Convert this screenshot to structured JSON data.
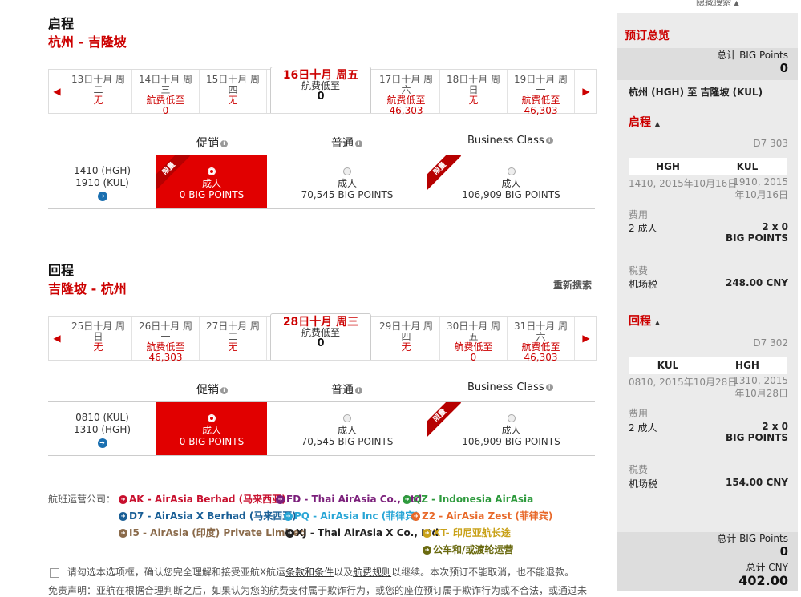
{
  "outbound": {
    "title": "启程",
    "route": "杭州 - 吉隆坡",
    "dates": [
      {
        "l1": "13日十月 周",
        "l2": "二",
        "p1": "无",
        "p2": ""
      },
      {
        "l1": "14日十月 周",
        "l2": "三",
        "p1": "航费低至",
        "p2": "0"
      },
      {
        "l1": "15日十月 周",
        "l2": "四",
        "p1": "无",
        "p2": ""
      },
      {
        "l1": "16日十月 周五",
        "l2": "航费低至",
        "p1": "0",
        "p2": "",
        "active": true
      },
      {
        "l1": "17日十月 周",
        "l2": "六",
        "p1": "航费低至",
        "p2": "46,303"
      },
      {
        "l1": "18日十月 周",
        "l2": "日",
        "p1": "无",
        "p2": ""
      },
      {
        "l1": "19日十月 周",
        "l2": "一",
        "p1": "航费低至",
        "p2": "46,303"
      }
    ],
    "times": {
      "dep": "1410 (HGH)",
      "arr": "1910 (KUL)"
    },
    "fares": [
      {
        "label": "成人",
        "points": "0 BIG POINTS"
      },
      {
        "label": "成人",
        "points": "70,545 BIG POINTS"
      },
      {
        "label": "成人",
        "points": "106,909 BIG POINTS"
      }
    ]
  },
  "return": {
    "title": "回程",
    "route": "吉隆坡 - 杭州",
    "research": "重新搜索",
    "dates": [
      {
        "l1": "25日十月 周",
        "l2": "日",
        "p1": "无",
        "p2": ""
      },
      {
        "l1": "26日十月 周",
        "l2": "一",
        "p1": "航费低至",
        "p2": "46,303"
      },
      {
        "l1": "27日十月 周",
        "l2": "二",
        "p1": "无",
        "p2": ""
      },
      {
        "l1": "28日十月 周三",
        "l2": "航费低至",
        "p1": "0",
        "p2": "",
        "active": true
      },
      {
        "l1": "29日十月 周",
        "l2": "四",
        "p1": "无",
        "p2": ""
      },
      {
        "l1": "30日十月 周",
        "l2": "五",
        "p1": "航费低至",
        "p2": "0"
      },
      {
        "l1": "31日十月 周",
        "l2": "六",
        "p1": "航费低至",
        "p2": "46,303"
      }
    ],
    "times": {
      "dep": "0810 (KUL)",
      "arr": "1310 (HGH)"
    },
    "fares": [
      {
        "label": "成人",
        "points": "0 BIG POINTS"
      },
      {
        "label": "成人",
        "points": "70,545 BIG POINTS"
      },
      {
        "label": "成人",
        "points": "106,909 BIG POINTS"
      }
    ]
  },
  "columns": {
    "promo": "促销",
    "regular": "普通",
    "business": "Business Class"
  },
  "ribbon": "限量",
  "carriers": {
    "label": "航班运营公司：",
    "items": [
      {
        "text": "AK - AirAsia Berhad (马来西亚)",
        "color": "#c8102e"
      },
      {
        "text": "FD - Thai AirAsia Co., Ltd",
        "color": "#7b1f7b"
      },
      {
        "text": "QZ - Indonesia AirAsia",
        "color": "#2e9a3d"
      },
      {
        "text": "D7 - AirAsia X Berhad (马来西亚)",
        "color": "#1a5f96"
      },
      {
        "text": "PQ - AirAsia Inc (菲律宾)",
        "color": "#29a6d6"
      },
      {
        "text": "Z2 - AirAsia Zest (菲律宾)",
        "color": "#e8692a"
      },
      {
        "text": "I5 - AirAsia (印度) Private Limited",
        "color": "#8a6a4a"
      },
      {
        "text": "XJ - Thai AirAsia X Co., Ltd",
        "color": "#222222"
      },
      {
        "text": "XT- 印尼亚航长途",
        "color": "#c9a21a"
      },
      {
        "text": "公车和/或渡轮运营",
        "color": "#6a6a10"
      }
    ]
  },
  "terms": {
    "pre": "请勾选本选项框，确认您完全理解和接受亚航X航运",
    "link1": "条款和条件",
    "mid": "以及",
    "link2": "航费规则",
    "post": "以继续。本次预订不能取消，也不能退款。"
  },
  "disclaimer": "免责声明：亚航在根据合理判断之后，如果认为您的航费支付属于欺诈行为，或您的座位预订属于欺诈行为或不合法，或通过未",
  "hide_search": "隐藏搜索",
  "sidebar": {
    "title": "预订总览",
    "total_label": "总计 BIG Points",
    "total_top": "0",
    "route": "杭州 (HGH) 至 吉隆坡 (KUL)",
    "out": {
      "title": "启程",
      "flight": "D7 303",
      "from": "HGH",
      "to": "KUL",
      "dep": "1410, 2015年10月16日",
      "arr1": "1910, 2015",
      "arr2": "年10月16日",
      "fee_label": "费用",
      "pax": "2 成人",
      "qty": "2 x 0",
      "unit": "BIG POINTS",
      "tax_label": "税费",
      "tax_name": "机场税",
      "tax_amount": "248.00 CNY"
    },
    "ret": {
      "title": "回程",
      "flight": "D7 302",
      "from": "KUL",
      "to": "HGH",
      "dep": "0810, 2015年10月28日",
      "arr1": "1310, 2015",
      "arr2": "年10月28日",
      "fee_label": "费用",
      "pax": "2 成人",
      "qty": "2 x 0",
      "unit": "BIG POINTS",
      "tax_label": "税费",
      "tax_name": "机场税",
      "tax_amount": "154.00 CNY"
    },
    "total_bottom_label": "总计 BIG Points",
    "total_bottom": "0",
    "total_cny_label": "总计 CNY",
    "total_cny": "402.00"
  }
}
